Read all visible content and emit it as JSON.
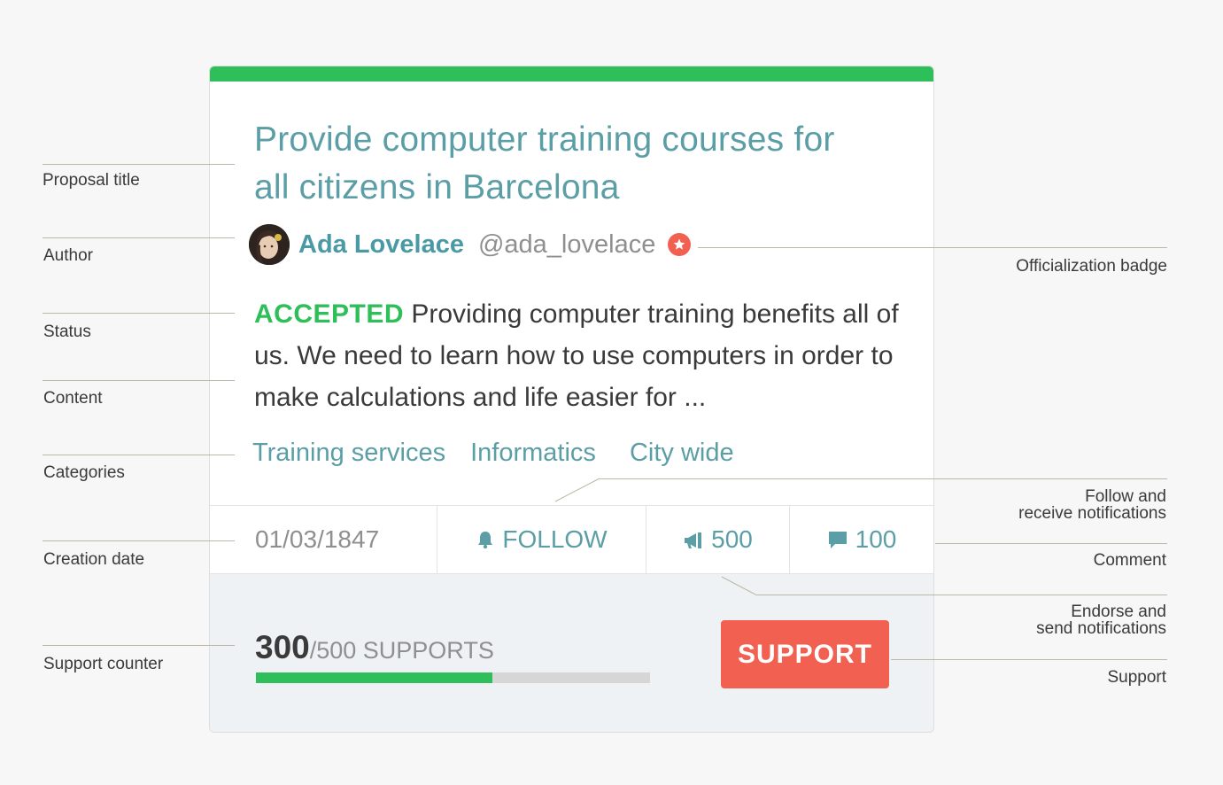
{
  "proposal": {
    "title": "Provide computer training courses for all citizens in Barcelona",
    "author_name": "Ada Lovelace",
    "author_nickname": "@ada_lovelace",
    "status": "ACCEPTED",
    "content": "Providing computer training benefits all of us. We need to learn how to use computers in order to make calculations and life easier for ...",
    "categories": [
      "Training services",
      "Informatics",
      "City wide"
    ],
    "creation_date": "01/03/1847",
    "follow_label": "FOLLOW",
    "endorsements": "500",
    "comments": "100",
    "supports_count": "300",
    "supports_total_label": "/500 SUPPORTS",
    "supports_progress": 0.6,
    "support_button_label": "SUPPORT"
  },
  "annotations": {
    "proposal_title": "Proposal title",
    "author": "Author",
    "status": "Status",
    "content": "Content",
    "categories": "Categories",
    "creation_date": "Creation date",
    "support_counter": "Support counter",
    "officialization_badge": "Officialization badge",
    "follow_line1": "Follow and",
    "follow_line2": "receive notifications",
    "comment": "Comment",
    "endorse_line1": "Endorse and",
    "endorse_line2": "send notifications",
    "support": "Support"
  },
  "colors": {
    "accent_green": "#2ebf5a",
    "link_teal": "#5b9ea6",
    "support_red": "#f16050"
  }
}
